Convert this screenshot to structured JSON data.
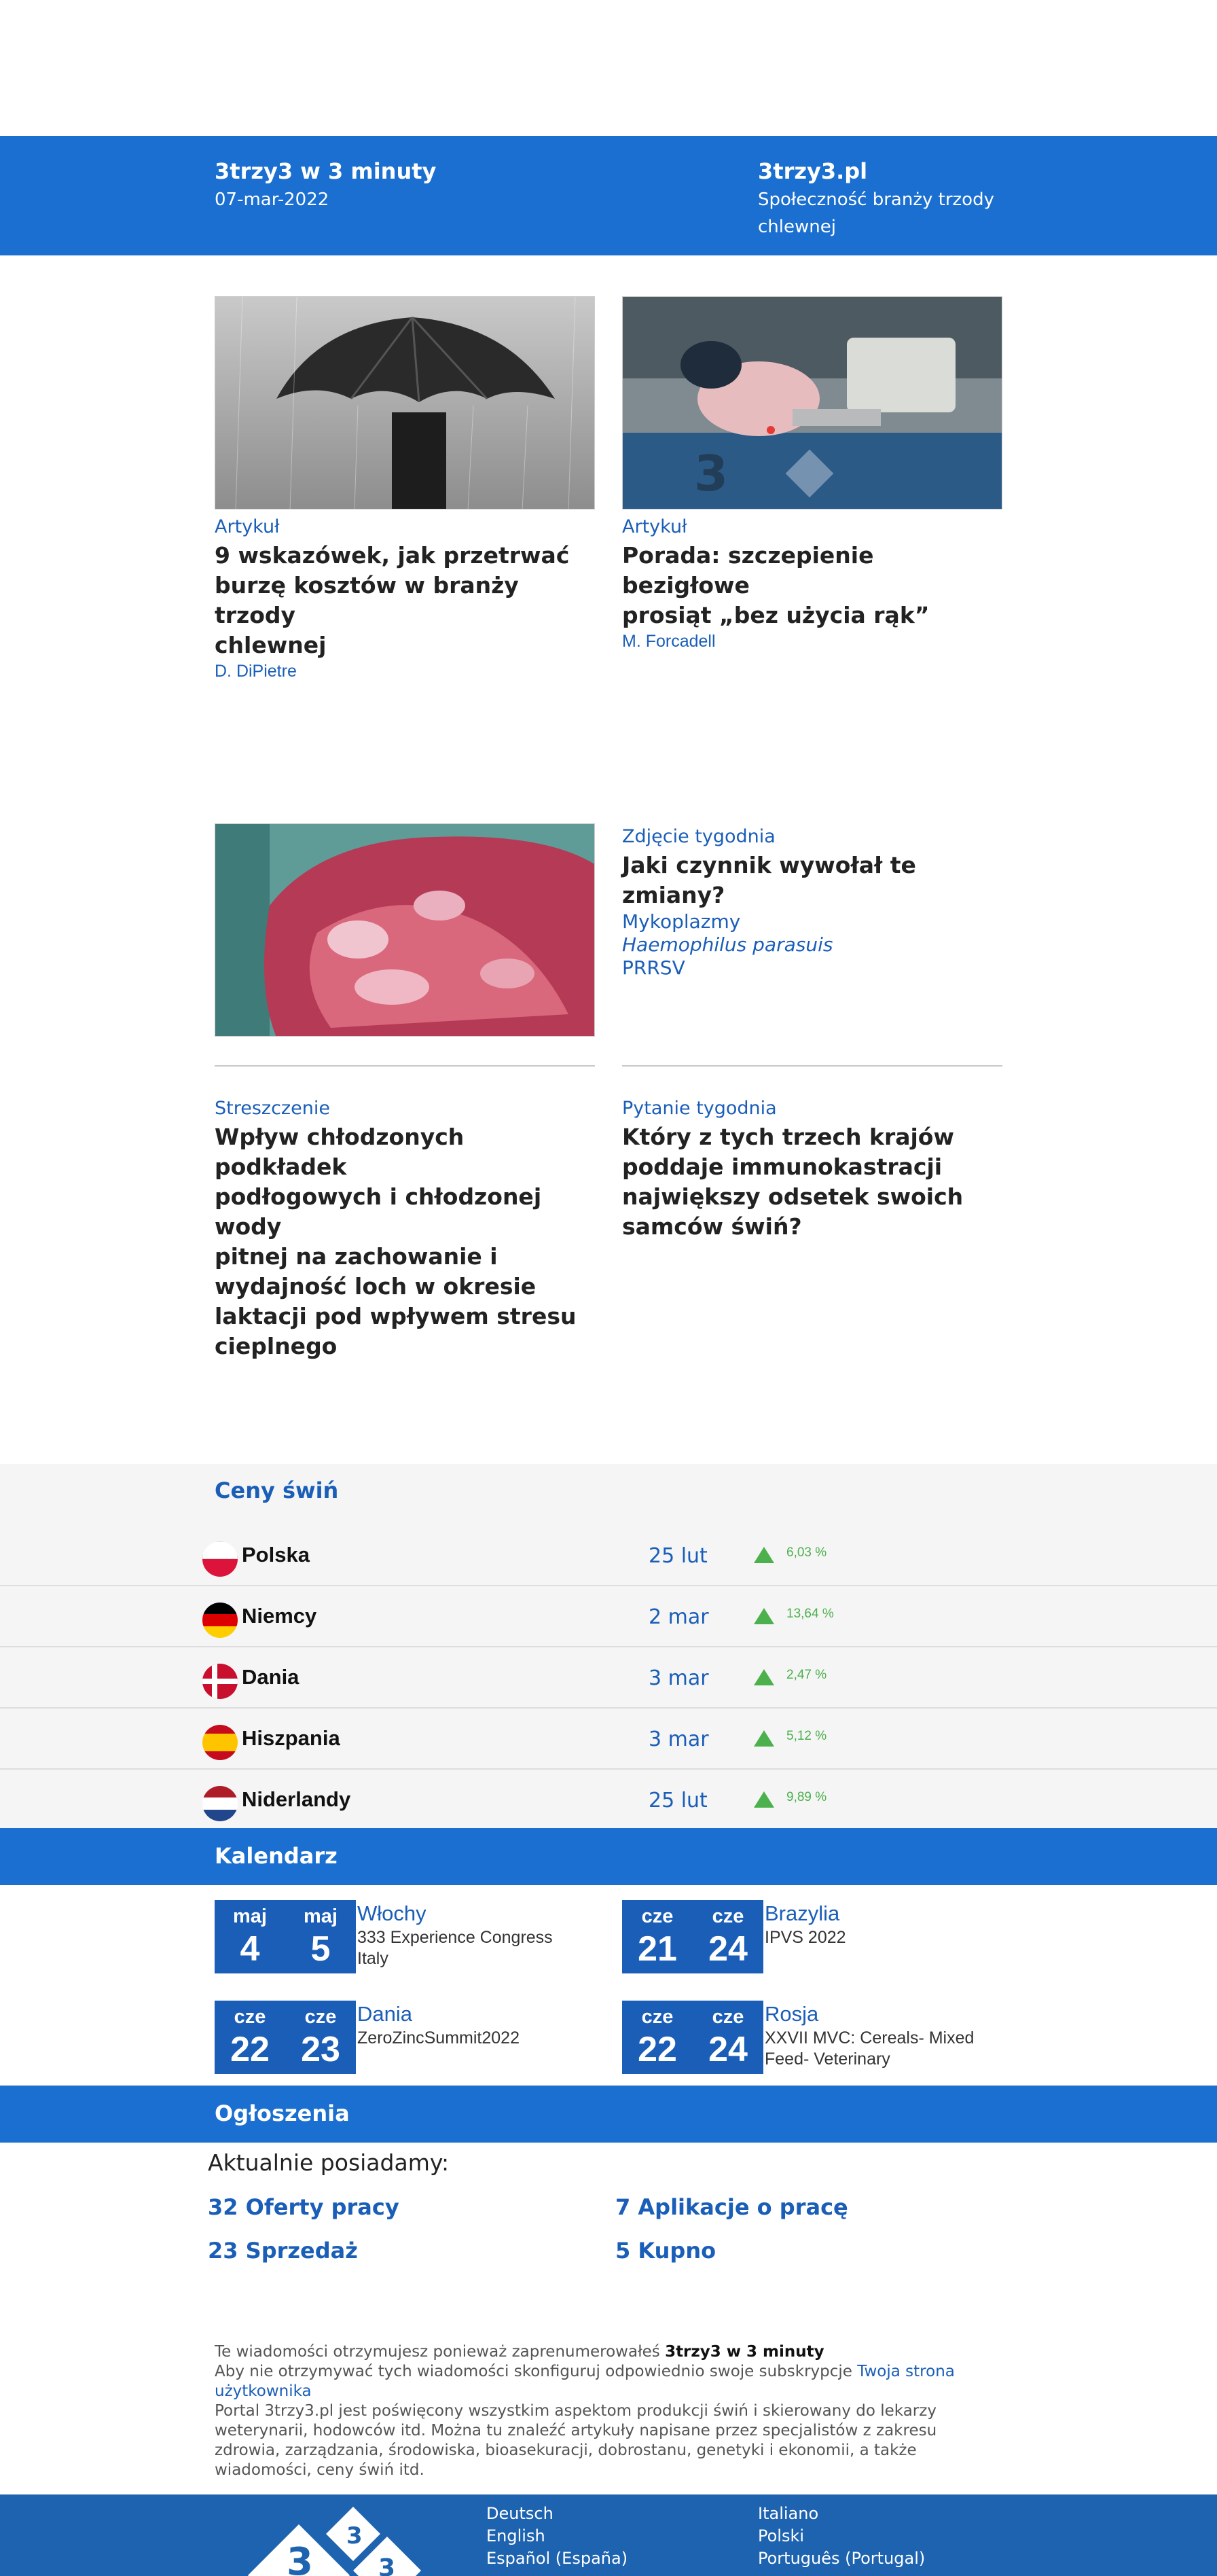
{
  "header": {
    "title": "3trzy3 w 3 minuty",
    "date": "07-mar-2022",
    "site": "3trzy3.pl",
    "tagline_1": "Społeczność branży trzody",
    "tagline_2": "chlewnej"
  },
  "articles": [
    {
      "kicker": "Artykuł",
      "headline_1": "9 wskazówek, jak przetrwać",
      "headline_2": "burzę kosztów w branży trzody",
      "headline_3": "chlewnej",
      "author": "D. DiPietre"
    },
    {
      "kicker": "Artykuł",
      "headline_1": "Porada: szczepienie bezigłowe",
      "headline_2": "prosiąt „bez użycia rąk”",
      "author": "M. Forcadell"
    }
  ],
  "photo_week": {
    "kicker": "Zdjęcie tygodnia",
    "question": "Jaki czynnik wywołał te zmiany?",
    "options": [
      "Mykoplazmy",
      "Haemophilus parasuis",
      "PRRSV"
    ]
  },
  "summary": {
    "kicker": "Streszczenie",
    "lines": [
      "Wpływ chłodzonych podkładek",
      "podłogowych i chłodzonej wody",
      "pitnej na zachowanie i",
      "wydajność loch w okresie",
      "laktacji pod wpływem stresu",
      "cieplnego"
    ]
  },
  "question_week": {
    "kicker": "Pytanie tygodnia",
    "lines": [
      "Który z tych trzech krajów",
      "poddaje immunokastracji",
      "największy odsetek swoich",
      "samców świń?"
    ]
  },
  "prices": {
    "title": "Ceny świń",
    "rows": [
      {
        "country": "Polska",
        "date": "25 lut",
        "change": "6,03 %"
      },
      {
        "country": "Niemcy",
        "date": "2 mar",
        "change": "13,64 %"
      },
      {
        "country": "Dania",
        "date": "3 mar",
        "change": "2,47 %"
      },
      {
        "country": "Hiszpania",
        "date": "3 mar",
        "change": "5,12 %"
      },
      {
        "country": "Niderlandy",
        "date": "25 lut",
        "change": "9,89 %"
      }
    ]
  },
  "calendar": {
    "title": "Kalendarz",
    "events": [
      {
        "m1": "maj",
        "d1": "4",
        "m2": "maj",
        "d2": "5",
        "where": "Włochy",
        "what_1": "333 Experience Congress",
        "what_2": "Italy"
      },
      {
        "m1": "cze",
        "d1": "21",
        "m2": "cze",
        "d2": "24",
        "where": "Brazylia",
        "what_1": "IPVS 2022",
        "what_2": ""
      },
      {
        "m1": "cze",
        "d1": "22",
        "m2": "cze",
        "d2": "23",
        "where": "Dania",
        "what_1": "ZeroZincSummit2022",
        "what_2": ""
      },
      {
        "m1": "cze",
        "d1": "22",
        "m2": "cze",
        "d2": "24",
        "where": "Rosja",
        "what_1": "XXVII MVC: Cereals- Mixed",
        "what_2": "Feed- Veterinary"
      }
    ]
  },
  "ads": {
    "title": "Ogłoszenia",
    "intro": "Aktualnie posiadamy:",
    "items": [
      "32 Oferty pracy",
      "7 Aplikacje o pracę",
      "23 Sprzedaż",
      "5 Kupno"
    ]
  },
  "footer": {
    "line1_pre": "Te wiadomości otrzymujesz ponieważ zaprenumerowałeś",
    "line1_bold": "3trzy3 w 3 minuty",
    "line2_pre": "Aby nie otrzymywać tych wiadomości skonfiguruj odpowiednio swoje subskrypcje",
    "link": "Twoja strona użytkownika",
    "about": "Portal 3trzy3.pl jest poświęcony wszystkim aspektom produkcji świń i skierowany do lekarzy weterynarii, hodowców itd. Można tu znaleźć artykuły napisane przez specjalistów z zakresu zdrowia, zarządzania, środowiska, bioasekuracji, dobrostanu, genetyki i ekonomii, a także wiadomości, ceny świń itd.",
    "languages_left": [
      "Deutsch",
      "English",
      "Español (España)"
    ],
    "languages_right": [
      "Italiano",
      "Polski",
      "Português (Portugal)"
    ]
  },
  "colors": {
    "brand_blue": "#1a6fd0",
    "link_blue": "#1a5eb8",
    "price_up": "#4cb14c"
  },
  "icons": {
    "price_trend": "triangle-up-icon",
    "logo": "333-logo"
  }
}
